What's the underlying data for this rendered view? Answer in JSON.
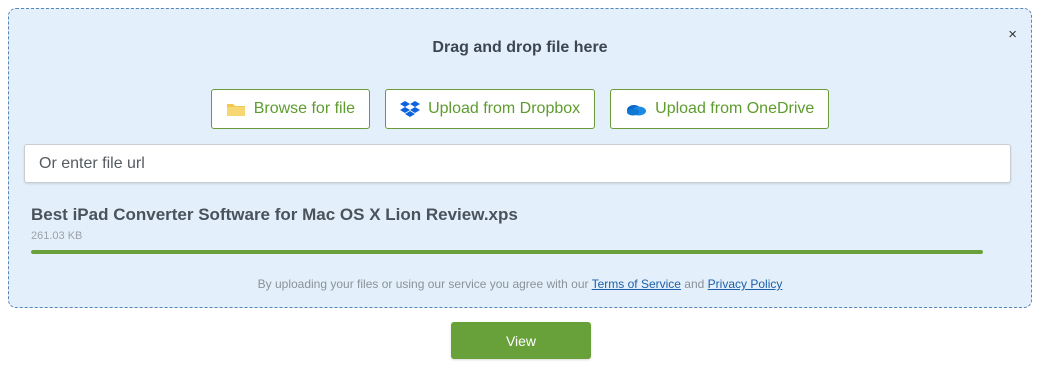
{
  "dropzone": {
    "title": "Drag and drop file here",
    "close_label": "×"
  },
  "buttons": {
    "browse": {
      "label": "Browse for file",
      "icon": "folder-icon"
    },
    "dropbox": {
      "label": "Upload from Dropbox",
      "icon": "dropbox-icon"
    },
    "onedrive": {
      "label": "Upload from OneDrive",
      "icon": "onedrive-icon"
    }
  },
  "url_input": {
    "placeholder": "Or enter file url",
    "value": ""
  },
  "file": {
    "name": "Best iPad Converter Software for Mac OS X Lion Review.xps",
    "size": "261.03 KB",
    "progress": 1.0
  },
  "terms": {
    "prefix": "By uploading your files or using our service you agree with our ",
    "tos_link": "Terms of Service",
    "conjunction": " and ",
    "privacy_link": "Privacy Policy"
  },
  "view_button": {
    "label": "View"
  },
  "colors": {
    "accent_green": "#68a03a",
    "dropzone_bg": "#e3f0fb",
    "link_blue": "#1f5fa8"
  }
}
